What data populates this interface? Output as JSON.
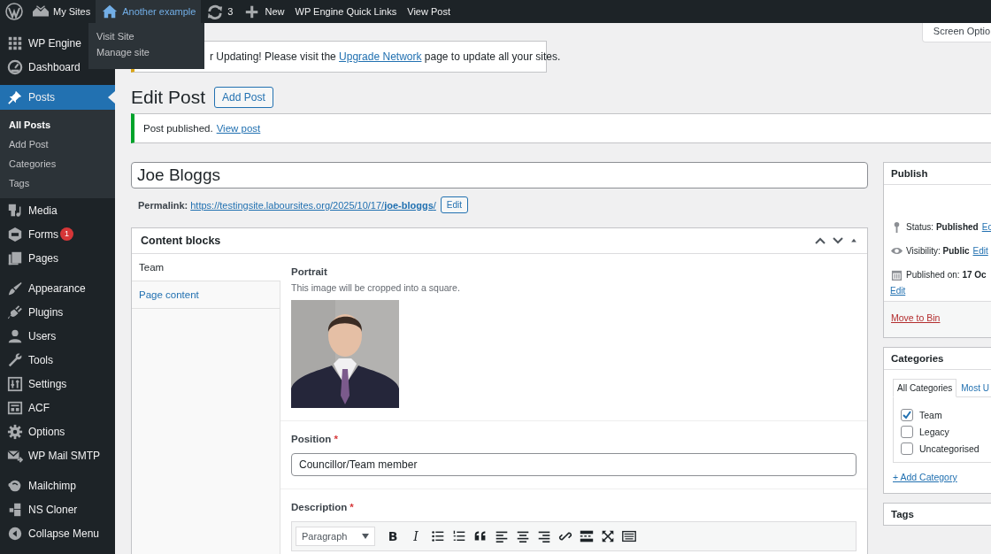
{
  "admin_bar": {
    "items": [
      {
        "label": "My Sites",
        "selected": false
      },
      {
        "label": "Another example",
        "selected": true
      },
      {
        "label": "3",
        "selected": false
      },
      {
        "label": "New",
        "selected": false
      },
      {
        "label": "WP Engine Quick Links",
        "selected": false
      },
      {
        "label": "View Post",
        "selected": false
      }
    ],
    "dropdown": [
      "Visit Site",
      "Manage site"
    ]
  },
  "sidebar": {
    "groups": [
      [
        {
          "label": "WP Engine",
          "selected": false
        },
        {
          "label": "Dashboard",
          "selected": false
        }
      ],
      [
        {
          "label": "Posts",
          "selected": true,
          "children": [
            {
              "label": "All Posts",
              "selected": true
            },
            {
              "label": "Add Post",
              "selected": false
            },
            {
              "label": "Categories",
              "selected": false
            },
            {
              "label": "Tags",
              "selected": false
            }
          ]
        },
        {
          "label": "Media",
          "selected": false
        },
        {
          "label": "Forms",
          "selected": false,
          "badge": "1"
        },
        {
          "label": "Pages",
          "selected": false
        }
      ],
      [
        {
          "label": "Appearance",
          "selected": false
        },
        {
          "label": "Plugins",
          "selected": false
        },
        {
          "label": "Users",
          "selected": false
        },
        {
          "label": "Tools",
          "selected": false
        },
        {
          "label": "Settings",
          "selected": false
        },
        {
          "label": "ACF",
          "selected": false
        },
        {
          "label": "Options",
          "selected": false
        },
        {
          "label": "WP Mail SMTP",
          "selected": false
        }
      ],
      [
        {
          "label": "Mailchimp",
          "selected": false
        },
        {
          "label": "NS Cloner",
          "selected": false
        },
        {
          "label": "Collapse Menu",
          "selected": false
        }
      ]
    ]
  },
  "screen_options": "Screen Optio",
  "upgrade_notice": {
    "text": "r Updating! Please visit the",
    "link": "Upgrade Network",
    "text_after": "page to update all your sites."
  },
  "heading": "Edit Post",
  "add_button": "Add Post",
  "published_notice": {
    "text": "Post published.",
    "link": "View post"
  },
  "title": "Joe Bloggs",
  "permalink": {
    "label": "Permalink:",
    "url": "https://testingsite.laboursites.org/2025/10/17/**joe-bloggs**/",
    "button": "Edit"
  },
  "content_blocks": {
    "title": "Content blocks",
    "tabs": [
      {
        "label": "Team",
        "selected": true
      },
      {
        "label": "Page content",
        "selected": false
      }
    ],
    "fields": [
      {
        "label": "Portrait",
        "instructions": "This image will be cropped into a square."
      },
      {
        "kind": "text",
        "label": "Position",
        "required_mark": "*",
        "value": "Councillor/Team member"
      },
      {
        "kind": "editor",
        "label": "Description",
        "required_mark": "*",
        "format": "Paragraph",
        "toolbar": [
          {
            "kind": "bold",
            "label": "B"
          },
          {
            "kind": "italic",
            "label": "I"
          },
          {
            "kind": "bullet-list"
          },
          {
            "kind": "number-list"
          },
          {
            "kind": "quote"
          },
          {
            "kind": "align-left"
          },
          {
            "kind": "align-center"
          },
          {
            "kind": "align-right"
          },
          {
            "kind": "link"
          },
          {
            "kind": "more"
          },
          {
            "kind": "fullscreen"
          },
          {
            "kind": "keyboard"
          }
        ]
      }
    ]
  },
  "publish": {
    "title": "Publish",
    "rows": [
      {
        "kind": "status",
        "label": "Status:",
        "value": "Published",
        "link": "Ec"
      },
      {
        "kind": "visibility",
        "label": "Visibility:",
        "value": "Public",
        "link": "Edit"
      },
      {
        "kind": "date",
        "label": "Published on:",
        "value": "17 Oc",
        "link": "Edit"
      }
    ],
    "delete": "Move to Bin"
  },
  "categories": {
    "title": "Categories",
    "tabs": [
      {
        "label": "All Categories",
        "selected": true
      },
      {
        "label": "Most U",
        "selected": false
      }
    ],
    "items": [
      {
        "label": "Team",
        "checked": true
      },
      {
        "label": "Legacy",
        "checked": false
      },
      {
        "label": "Uncategorised",
        "checked": false
      }
    ],
    "add": "+ Add Category"
  },
  "tags": {
    "title": "Tags"
  }
}
